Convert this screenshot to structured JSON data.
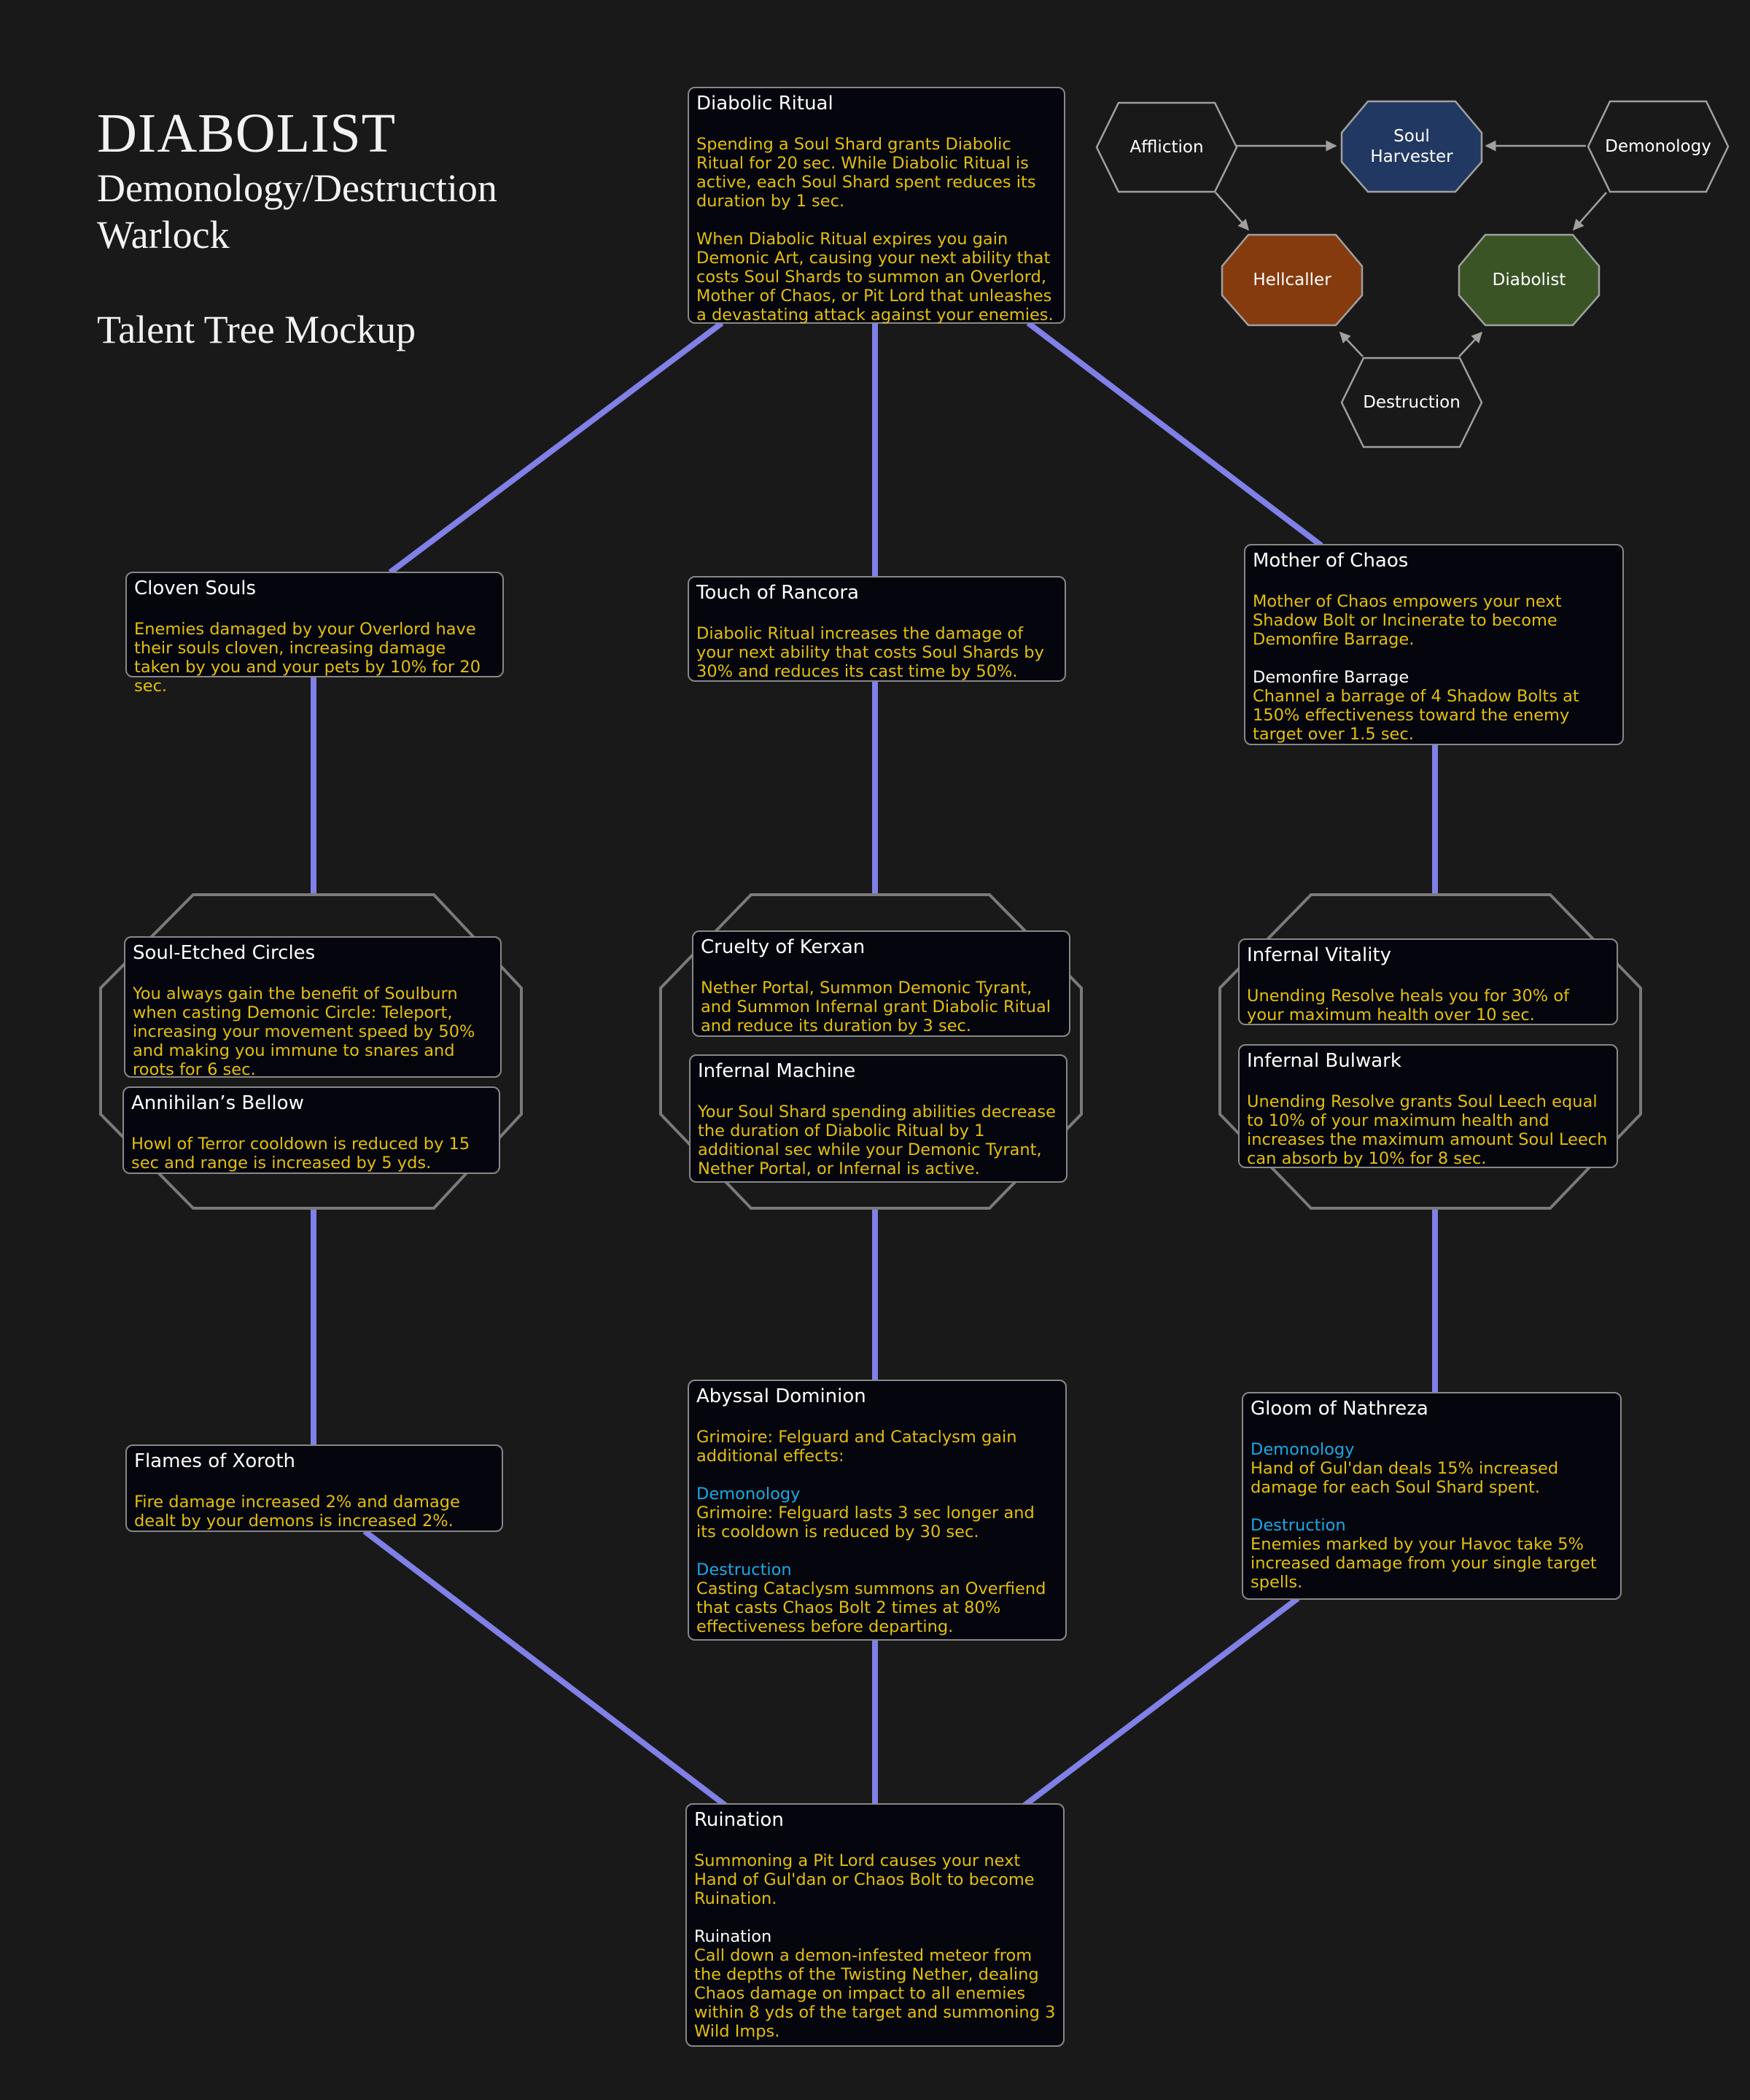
{
  "header": {
    "title": "DIABOLIST",
    "subtitle_line1": "Demonology/Destruction",
    "subtitle_line2": "Warlock",
    "mockup_label": "Talent Tree Mockup"
  },
  "colors": {
    "background": "#191919",
    "card_background": "#05050d",
    "card_border": "#888888",
    "talent_name": "#ffffff",
    "description_text": "#e3bf0f",
    "spec_label": "#19a9e3",
    "connector": "#8080e8",
    "choice_octagon": "#7a7a7a"
  },
  "spec_diagram": {
    "nodes": [
      {
        "id": "affliction",
        "label": "Affliction",
        "shape": "hexagon",
        "fill": "#191919"
      },
      {
        "id": "soul-harvester",
        "label": "Soul\nHarvester",
        "shape": "octagon",
        "fill": "#213862"
      },
      {
        "id": "demonology",
        "label": "Demonology",
        "shape": "hexagon",
        "fill": "#191919"
      },
      {
        "id": "hellcaller",
        "label": "Hellcaller",
        "shape": "octagon",
        "fill": "#853b0d"
      },
      {
        "id": "diabolist",
        "label": "Diabolist",
        "shape": "octagon",
        "fill": "#3a5426"
      },
      {
        "id": "destruction",
        "label": "Destruction",
        "shape": "hexagon",
        "fill": "#191919"
      }
    ],
    "arrows": [
      {
        "from": "affliction",
        "to": "soul-harvester"
      },
      {
        "from": "demonology",
        "to": "soul-harvester"
      },
      {
        "from": "affliction",
        "to": "hellcaller"
      },
      {
        "from": "demonology",
        "to": "diabolist"
      },
      {
        "from": "destruction",
        "to": "hellcaller"
      },
      {
        "from": "destruction",
        "to": "diabolist"
      }
    ]
  },
  "talents": {
    "diabolic_ritual": {
      "name": "Diabolic Ritual",
      "desc1": "Spending a Soul Shard grants Diabolic Ritual for 20 sec. While Diabolic Ritual is active, each Soul Shard spent reduces its duration by 1 sec.",
      "desc2": "When Diabolic Ritual expires you gain Demonic Art, causing your next ability that costs Soul Shards to summon an Overlord, Mother of Chaos, or Pit Lord that unleashes a devastating attack against your enemies."
    },
    "cloven_souls": {
      "name": "Cloven Souls",
      "desc": "Enemies damaged by your Overlord have their souls cloven, increasing damage taken by you and your pets by 10% for 20 sec."
    },
    "touch_of_rancora": {
      "name": "Touch of Rancora",
      "desc": "Diabolic Ritual increases the damage of your next ability that costs Soul Shards by 30% and reduces its cast time by 50%."
    },
    "mother_of_chaos": {
      "name": "Mother of Chaos",
      "desc": "Mother of Chaos empowers your next Shadow Bolt or Incinerate to become Demonfire Barrage.",
      "sub_name": "Demonfire Barrage",
      "sub_desc": "Channel a barrage of 4 Shadow Bolts at 150% effectiveness toward the enemy target over 1.5 sec."
    },
    "soul_etched_circles": {
      "name": "Soul-Etched Circles",
      "desc": "You always gain the benefit of Soulburn when casting Demonic Circle: Teleport, increasing your movement speed by 50% and making you immune to snares and roots for 6 sec."
    },
    "annihilans_bellow": {
      "name": "Annihilan’s Bellow",
      "desc": "Howl of Terror cooldown is reduced by 15 sec and range is increased by 5 yds."
    },
    "cruelty_of_kerxan": {
      "name": "Cruelty of Kerxan",
      "desc": "Nether Portal, Summon Demonic Tyrant, and Summon Infernal grant Diabolic Ritual and reduce its duration by 3 sec."
    },
    "infernal_machine": {
      "name": "Infernal Machine",
      "desc": "Your Soul Shard spending abilities decrease the duration of Diabolic Ritual by 1 additional sec while your Demonic Tyrant, Nether Portal, or Infernal is active."
    },
    "infernal_vitality": {
      "name": "Infernal Vitality",
      "desc": "Unending Resolve heals you for 30% of your maximum health over 10 sec."
    },
    "infernal_bulwark": {
      "name": "Infernal Bulwark",
      "desc": "Unending Resolve grants Soul Leech equal to 10% of your maximum health and increases the maximum amount Soul Leech can absorb by 10% for 8 sec."
    },
    "flames_of_xoroth": {
      "name": "Flames of Xoroth",
      "desc": "Fire damage increased 2% and damage dealt by your demons is increased 2%."
    },
    "abyssal_dominion": {
      "name": "Abyssal Dominion",
      "desc": "Grimoire: Felguard and Cataclysm gain additional effects:",
      "spec1_label": "Demonology",
      "spec1_desc": "Grimoire: Felguard lasts 3 sec longer and its cooldown is reduced by 30 sec.",
      "spec2_label": "Destruction",
      "spec2_desc": "Casting Cataclysm summons an Overfiend that casts Chaos Bolt 2 times at 80% effectiveness before departing."
    },
    "gloom_of_nathreza": {
      "name": "Gloom of Nathreza",
      "spec1_label": "Demonology",
      "spec1_desc": "Hand of Gul'dan deals 15% increased damage for each Soul Shard spent.",
      "spec2_label": "Destruction",
      "spec2_desc": "Enemies marked by your Havoc take 5% increased damage from your single target spells."
    },
    "ruination": {
      "name": "Ruination",
      "desc": "Summoning a Pit Lord causes your next Hand of Gul'dan or Chaos Bolt to become Ruination.",
      "sub_name": "Ruination",
      "sub_desc": "Call down a demon-infested meteor from the depths of the Twisting Nether, dealing Chaos damage on impact to all enemies within 8 yds of the target and summoning 3 Wild Imps."
    }
  }
}
